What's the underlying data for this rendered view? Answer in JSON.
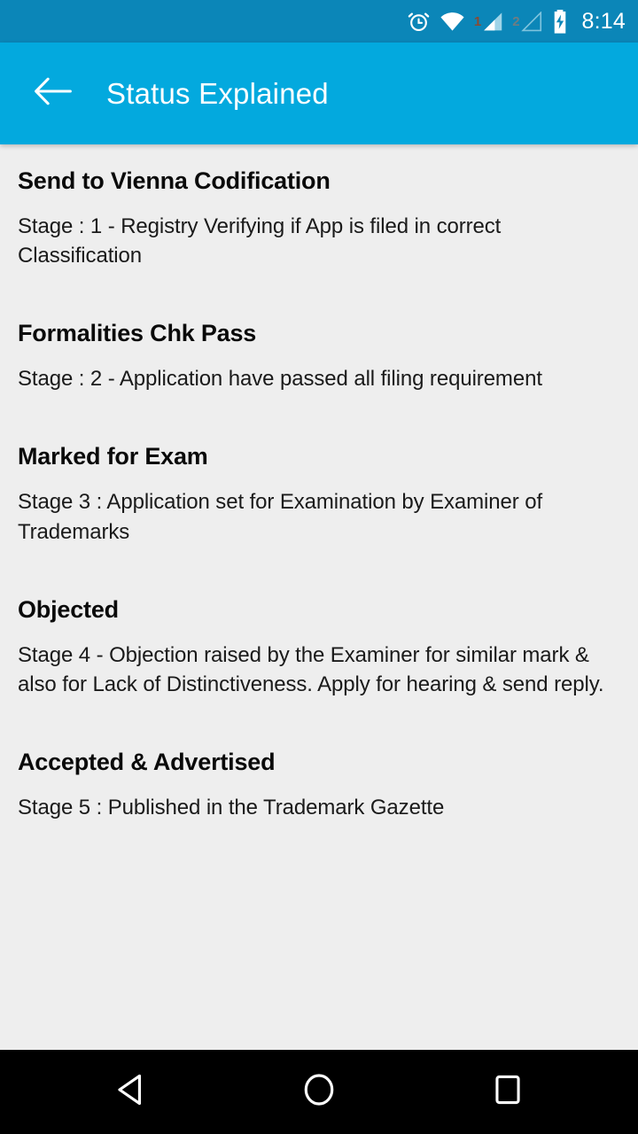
{
  "statusbar": {
    "icons": [
      "alarm-icon",
      "wifi-icon",
      "sim1-signal-icon",
      "sim2-signal-icon",
      "battery-charging-icon"
    ],
    "sim1_label": "1",
    "sim2_label": "2",
    "time": "8:14",
    "background_color": "#0b86b8"
  },
  "appbar": {
    "back_icon": "arrow-left-icon",
    "title": "Status Explained",
    "background_color": "#03a9de",
    "text_color": "#ffffff"
  },
  "content": {
    "background_color": "#eeeeee",
    "entries": [
      {
        "title": "Send to Vienna Codification",
        "description": "Stage : 1 - Registry Verifying if App is filed in correct Classification"
      },
      {
        "title": "Formalities Chk Pass",
        "description": "Stage : 2 - Application have passed all filing requirement"
      },
      {
        "title": "Marked for Exam",
        "description": "Stage 3 : Application set for Examination by Examiner of Trademarks"
      },
      {
        "title": "Objected",
        "description": "Stage 4 - Objection raised by the Examiner for similar mark & also for Lack of Distinctiveness. Apply for hearing & send reply."
      },
      {
        "title": "Accepted & Advertised",
        "description": "Stage 5 : Published in the Trademark Gazette"
      }
    ]
  },
  "navbar": {
    "background_color": "#000000",
    "buttons": [
      {
        "name": "back-triangle-icon"
      },
      {
        "name": "home-circle-icon"
      },
      {
        "name": "recents-square-icon"
      }
    ]
  }
}
